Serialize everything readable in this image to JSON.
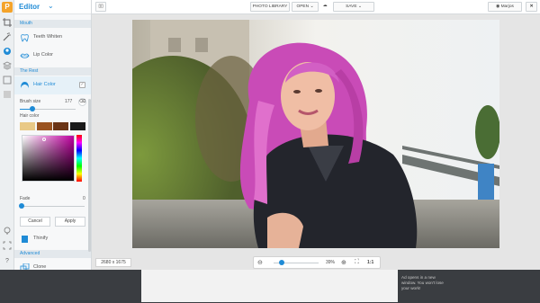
{
  "app": {
    "logo_letter": "P"
  },
  "panel": {
    "title": "Editor",
    "sections": {
      "mouth": "Mouth",
      "the_rest": "The Rest",
      "advanced": "Advanced"
    },
    "items": {
      "teeth": "Teeth Whiten",
      "lip": "Lip Color",
      "hair": "Hair Color",
      "thinify": "Thinify",
      "clone": "Clone"
    },
    "brush_size_label": "Brush size",
    "brush_size_value": "177",
    "brush_size_fraction": 0.22,
    "hair_color_label": "Hair color",
    "swatches": [
      "#e9c986",
      "#9a5320",
      "#6b3415",
      "#1a1a1a"
    ],
    "fade_label": "Fade",
    "fade_value": "0",
    "cancel_label": "Cancel",
    "apply_label": "Apply"
  },
  "topbar": {
    "photo_library": "PHOTO LIBRARY",
    "open": "OPEN",
    "save": "SAVE",
    "user": "Marjos",
    "close": "✕"
  },
  "canvas": {
    "dimensions": "2680 x 1675",
    "zoom": "39%",
    "zoom_fraction": 0.39,
    "fit_label": "1:1"
  },
  "ad": {
    "text": "Ad opens in a new window. You won't lose your work!"
  },
  "colors": {
    "accent": "#1f8bd6",
    "logo": "#f4a32a",
    "hair": "#c94bb7"
  }
}
